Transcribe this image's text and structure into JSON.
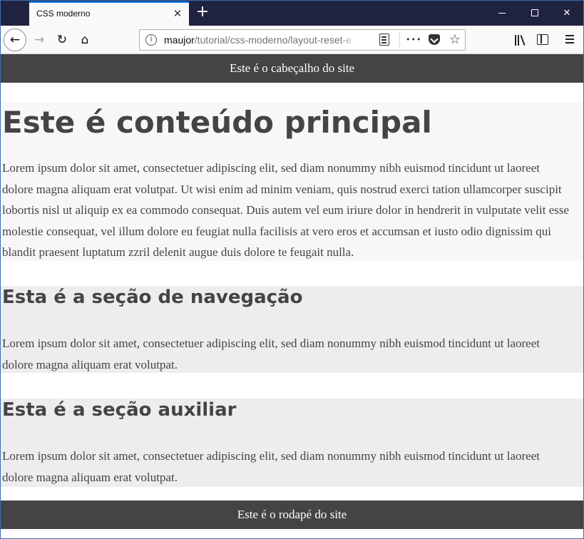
{
  "browser": {
    "tab": {
      "title": "CSS moderno",
      "close_icon": "close-icon"
    },
    "new_tab_icon": "plus-icon",
    "window_controls": {
      "minimize": "minimize-icon",
      "maximize": "maximize-icon",
      "close": "✕"
    },
    "nav": {
      "back_icon": "←",
      "forward_icon": "→",
      "reload_icon": "↻",
      "home_icon": "⌂"
    },
    "url": {
      "info_icon": "i",
      "host": "maujor",
      "path": "/tutorial/css-moderno/layout-reset-e",
      "reader_icon": "reader-mode-icon",
      "more_icon": "•••",
      "pocket_icon": "pocket-icon",
      "bookmark_icon": "☆"
    },
    "toolbar": {
      "library_icon": "library-icon",
      "sidebar_icon": "sidebar-icon",
      "menu_icon": "hamburger-menu-icon"
    }
  },
  "page": {
    "header_text": "Este é o cabeçalho do site",
    "main": {
      "title": "Este é conteúdo principal",
      "text": "Lorem ipsum dolor sit amet, consectetuer adipiscing elit, sed diam nonummy nibh euismod tincidunt ut laoreet dolore magna aliquam erat volutpat. Ut wisi enim ad minim veniam, quis nostrud exerci tation ullamcorper suscipit lobortis nisl ut aliquip ex ea commodo consequat. Duis autem vel eum iriure dolor in hendrerit in vulputate velit esse molestie consequat, vel illum dolore eu feugiat nulla facilisis at vero eros et accumsan et iusto odio dignissim qui blandit praesent luptatum zzril delenit augue duis dolore te feugait nulla."
    },
    "nav_section": {
      "title": "Esta é a seção de navegação",
      "text": "Lorem ipsum dolor sit amet, consectetuer adipiscing elit, sed diam nonummy nibh euismod tincidunt ut laoreet dolore magna aliquam erat volutpat."
    },
    "aux_section": {
      "title": "Esta é a seção auxiliar",
      "text": "Lorem ipsum dolor sit amet, consectetuer adipiscing elit, sed diam nonummy nibh euismod tincidunt ut laoreet dolore magna aliquam erat volutpat."
    },
    "footer_text": "Este é o rodapé do site"
  },
  "colors": {
    "titlebar": "#202340",
    "tab_accent": "#0a84ff",
    "site_bar": "#444444",
    "main_bg": "#f7f7f7",
    "section_bg": "#ededed"
  }
}
